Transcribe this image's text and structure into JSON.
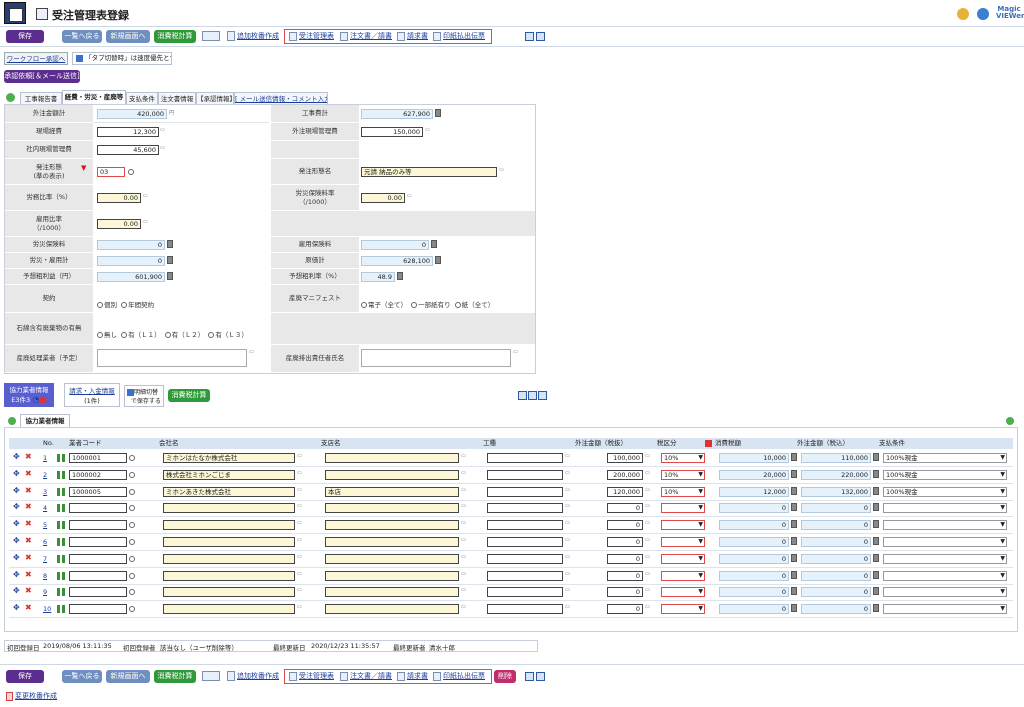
{
  "header": {
    "title": "受注管理表登録",
    "logo_line1": "Magic",
    "logo_line2": "VIEWer"
  },
  "toolbar": {
    "save": "保存",
    "back_to_list": "一覧へ戻る",
    "new_screen": "新規画面へ",
    "tax_calc": "消費税計算",
    "add_copy": "追加枚番作成",
    "links": [
      "受注管理表",
      "注文書／請書",
      "請求書",
      "印紙払出伝票"
    ],
    "delete": "削除",
    "change_copy": "変更枚番作成"
  },
  "workflow": {
    "button": "ワークフロー承認へ",
    "tab_switch_check": "「タブ切替時」は速度優先とする",
    "approval_request": "承認依頼[＆メール送信]"
  },
  "tabs": [
    "工事報告書",
    "経費・労災・産廃等",
    "支払条件",
    "注文書情報",
    "【承認情報】",
    "[ メール送信情報・コメント入力 ]"
  ],
  "form": {
    "outsource_total_label": "外注金額計",
    "outsource_total": "420,000",
    "outsource_total_unit": "円",
    "construction_total_label": "工事費計",
    "construction_total": "627,900",
    "site_expense_label": "現場経費",
    "site_expense": "12,300",
    "outsource_site_mgmt_label": "外注現場管理費",
    "outsource_site_mgmt": "150,000",
    "inhouse_site_mgmt_label": "社内現場管理費",
    "inhouse_site_mgmt": "45,600",
    "order_type_label": "発注形態",
    "order_type_label2": "(準の表示)",
    "order_type_code": "03",
    "order_type_name_label": "発注形態名",
    "order_type_name": "元請 納品のみ等",
    "labor_ratio_label": "労務比率（%）",
    "labor_ratio": "0.00",
    "workers_comp_rate_label": "労災保険料率",
    "workers_comp_rate_label2": "（/1000）",
    "workers_comp_rate": "0.00",
    "disability_ratio_label": "雇用比率",
    "disability_ratio_label2": "（/1000）",
    "disability_ratio": "0.00",
    "workers_comp_fee_label": "労災保険料",
    "workers_comp_fee": "0",
    "employment_ins_label": "雇用保険料",
    "employment_ins": "0",
    "comp_total_label": "労災・雇用計",
    "comp_total": "0",
    "cost_total_label": "原価計",
    "cost_total": "628,100",
    "expected_profit_label": "予想粗利益（円）",
    "expected_profit": "601,900",
    "expected_profit_rate_label": "予想粗利率（%）",
    "expected_profit_rate": "48.9",
    "contract_label": "契約",
    "contract_opts": [
      "個別",
      "年間契約"
    ],
    "manifest_label": "産廃マニフェスト",
    "manifest_opts": [
      "電子（全て）",
      "一部紙有り",
      "紙（全て）"
    ],
    "asbestos_label": "石綿含有廃棄物の有無",
    "asbestos_opts": [
      "無し",
      "有（Ｌ１）",
      "有（Ｌ２）",
      "有（Ｌ３）"
    ],
    "waste_handler_label": "産廃処理業者（予定）",
    "waste_responsible_label": "産廃排出責任者氏名"
  },
  "vendor_section": {
    "info_button": "協力業者情報",
    "info_sub": "E3件3",
    "billing_button": "請求・入金情報",
    "billing_count": "(1件)",
    "detail_switch_1": "明細切替",
    "detail_switch_2": "で保存する",
    "tax_calc": "消費税計算",
    "tab": "協力業者情報"
  },
  "vendor_table": {
    "headers": [
      "No.",
      "業者コード",
      "会社名",
      "支店名",
      "工種",
      "外注金額（税抜）",
      "税区分",
      "消費税額",
      "外注金額（税込）",
      "支払条件"
    ],
    "rows": [
      {
        "no": "1",
        "code": "1000001",
        "company": "ミホンはたなか株式会社",
        "branch": "",
        "amount": "100,000",
        "tax": "10%",
        "tax_amt": "10,000",
        "total": "110,000",
        "pay": "100%現金"
      },
      {
        "no": "2",
        "code": "1000002",
        "company": "株式会社ミホンごじま",
        "branch": "",
        "amount": "200,000",
        "tax": "10%",
        "tax_amt": "20,000",
        "total": "220,000",
        "pay": "100%現金"
      },
      {
        "no": "3",
        "code": "1000005",
        "company": "ミホンあきた株式会社",
        "branch": "本店",
        "amount": "120,000",
        "tax": "10%",
        "tax_amt": "12,000",
        "total": "132,000",
        "pay": "100%現金"
      },
      {
        "no": "4",
        "code": "",
        "company": "",
        "branch": "",
        "amount": "0",
        "tax": "",
        "tax_amt": "0",
        "total": "0",
        "pay": ""
      },
      {
        "no": "5",
        "code": "",
        "company": "",
        "branch": "",
        "amount": "0",
        "tax": "",
        "tax_amt": "0",
        "total": "0",
        "pay": ""
      },
      {
        "no": "6",
        "code": "",
        "company": "",
        "branch": "",
        "amount": "0",
        "tax": "",
        "tax_amt": "0",
        "total": "0",
        "pay": ""
      },
      {
        "no": "7",
        "code": "",
        "company": "",
        "branch": "",
        "amount": "0",
        "tax": "",
        "tax_amt": "0",
        "total": "0",
        "pay": ""
      },
      {
        "no": "8",
        "code": "",
        "company": "",
        "branch": "",
        "amount": "0",
        "tax": "",
        "tax_amt": "0",
        "total": "0",
        "pay": ""
      },
      {
        "no": "9",
        "code": "",
        "company": "",
        "branch": "",
        "amount": "0",
        "tax": "",
        "tax_amt": "0",
        "total": "0",
        "pay": ""
      },
      {
        "no": "10",
        "code": "",
        "company": "",
        "branch": "",
        "amount": "0",
        "tax": "",
        "tax_amt": "0",
        "total": "0",
        "pay": ""
      }
    ]
  },
  "footer": {
    "first_date_label": "初回登録日",
    "first_date": "2019/08/06 13:11:35",
    "first_user_label": "初回登録者",
    "first_user": "該当なし（ユーザ削除等）",
    "last_date_label": "最終更新日",
    "last_date": "2020/12/23 11:35:57",
    "last_user_label": "最終更新者",
    "last_user": "清水十郎"
  }
}
